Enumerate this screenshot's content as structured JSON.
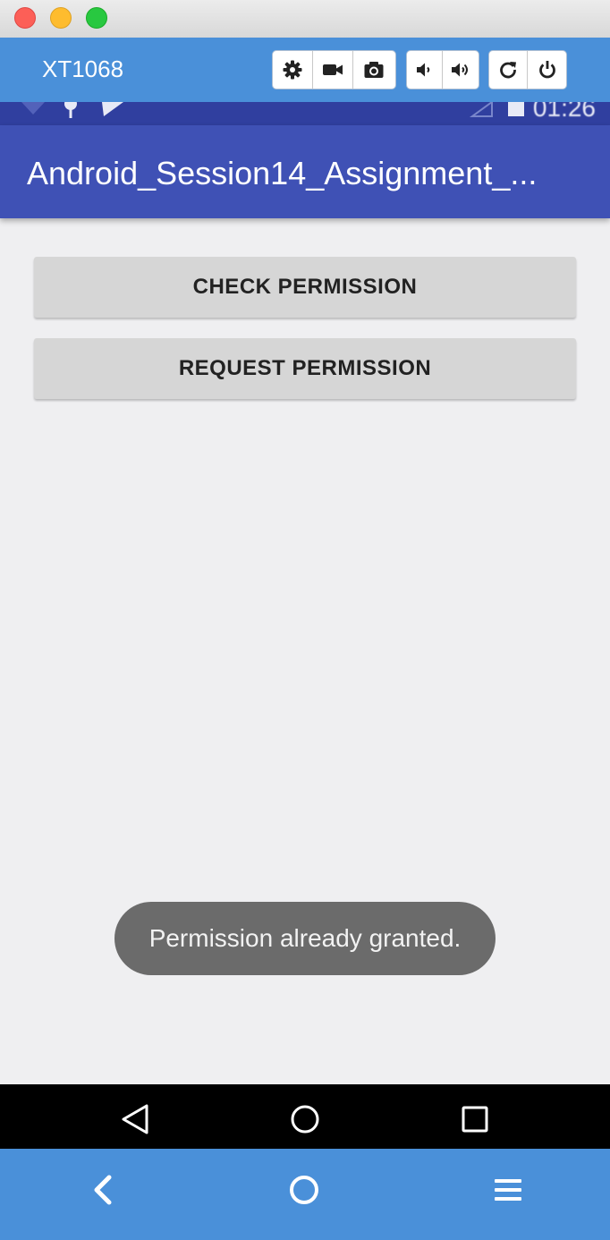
{
  "window": {
    "device_name": "XT1068"
  },
  "toolbar": {
    "groups": [
      [
        "gear-icon",
        "video-camera-icon",
        "camera-icon"
      ],
      [
        "volume-down-icon",
        "volume-up-icon"
      ],
      [
        "rotate-icon",
        "power-icon"
      ]
    ]
  },
  "status_bar": {
    "time": "01:26"
  },
  "app": {
    "title": "Android_Session14_Assignment_...",
    "check_permission_label": "CHECK PERMISSION",
    "request_permission_label": "REQUEST PERMISSION",
    "toast_message": "Permission already granted."
  },
  "android_nav": [
    "back-triangle-icon",
    "home-circle-icon",
    "recents-square-icon"
  ],
  "bottom_bar": [
    "chevron-left-icon",
    "home-circle-icon",
    "menu-icon"
  ],
  "colors": {
    "toolbar_blue": "#4a90d9",
    "app_bar": "#3f51b5",
    "status_bar": "#303f9f",
    "background": "#efeff1",
    "toast": "#6b6b6b"
  }
}
